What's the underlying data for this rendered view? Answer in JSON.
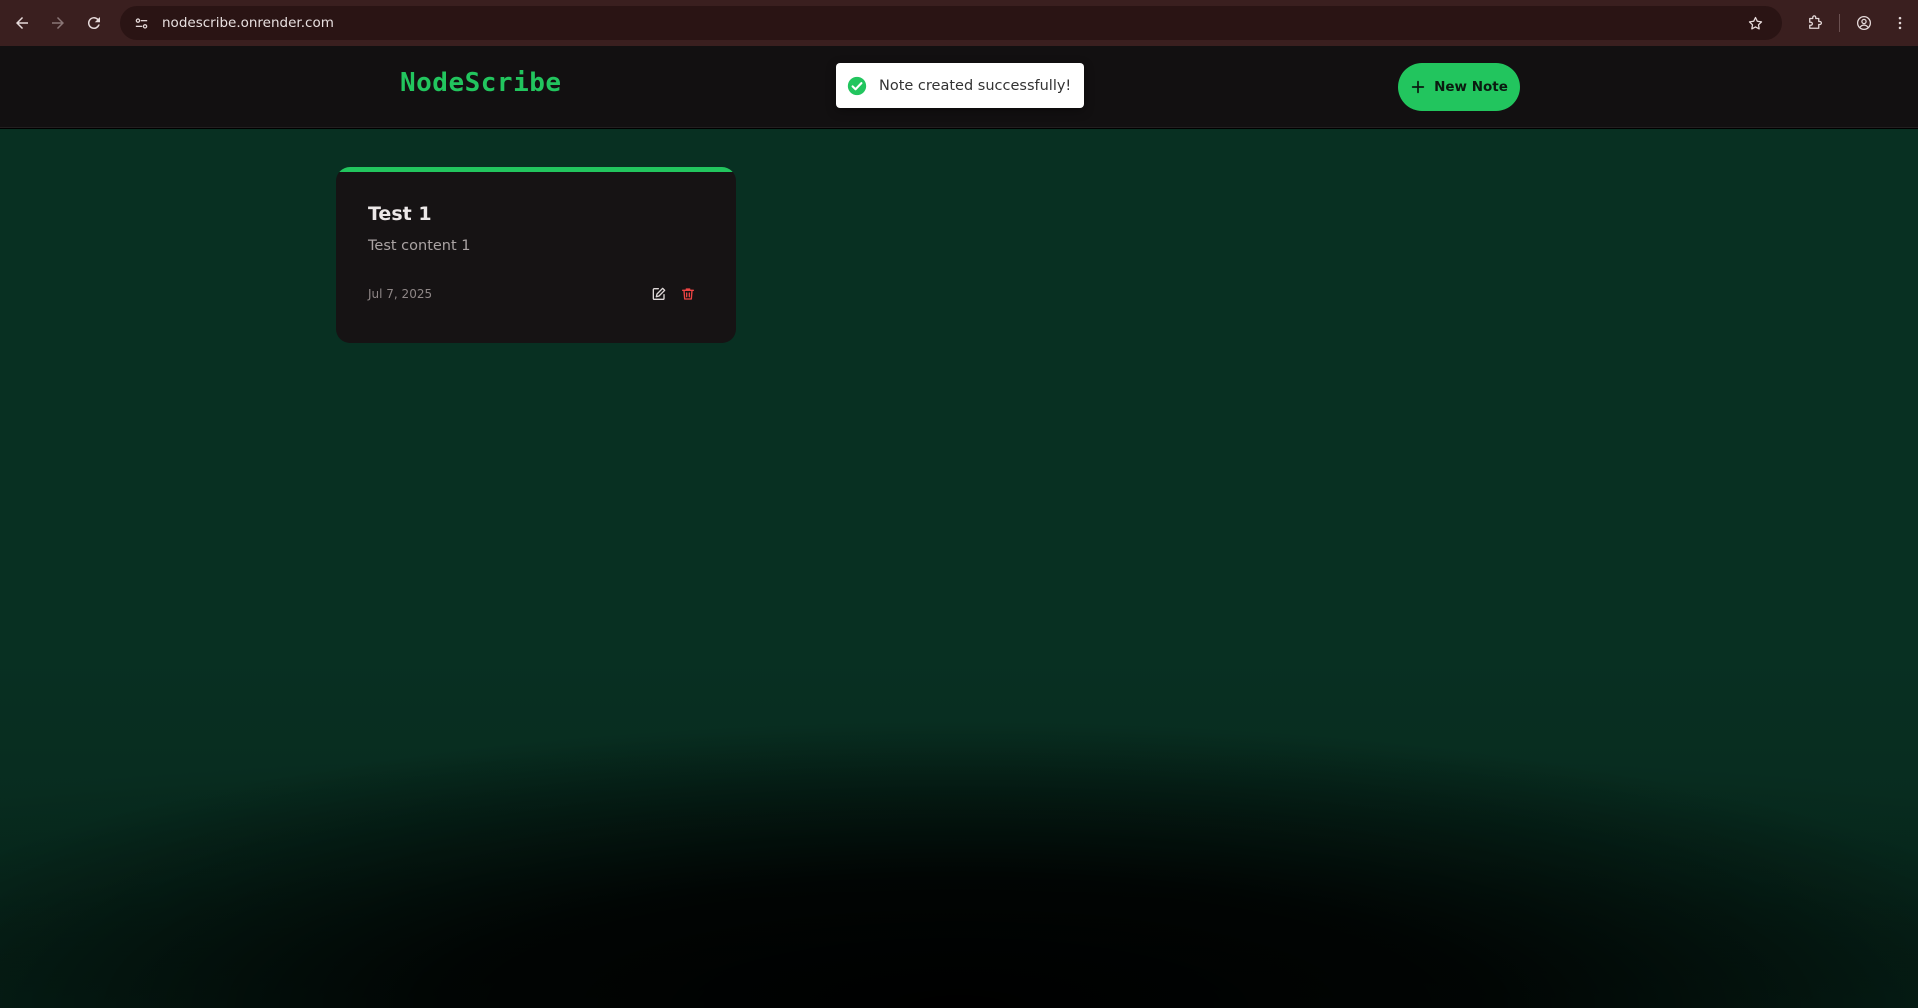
{
  "browser": {
    "url": "nodescribe.onrender.com",
    "icons": [
      "back-icon",
      "forward-icon",
      "reload-icon",
      "site-info-icon",
      "star-icon",
      "extensions-icon",
      "profile-icon",
      "menu-icon"
    ]
  },
  "header": {
    "logo": "NodeScribe",
    "new_note_label": "New Note",
    "brand_color": "#22c55e"
  },
  "toast": {
    "message": "Note created successfully!",
    "status_color": "#22c55e"
  },
  "notes": [
    {
      "title": "Test 1",
      "content": "Test content 1",
      "date": "Jul 7, 2025"
    }
  ],
  "colors": {
    "background": "#000000",
    "card": "#161314",
    "delete": "#ef4444"
  }
}
